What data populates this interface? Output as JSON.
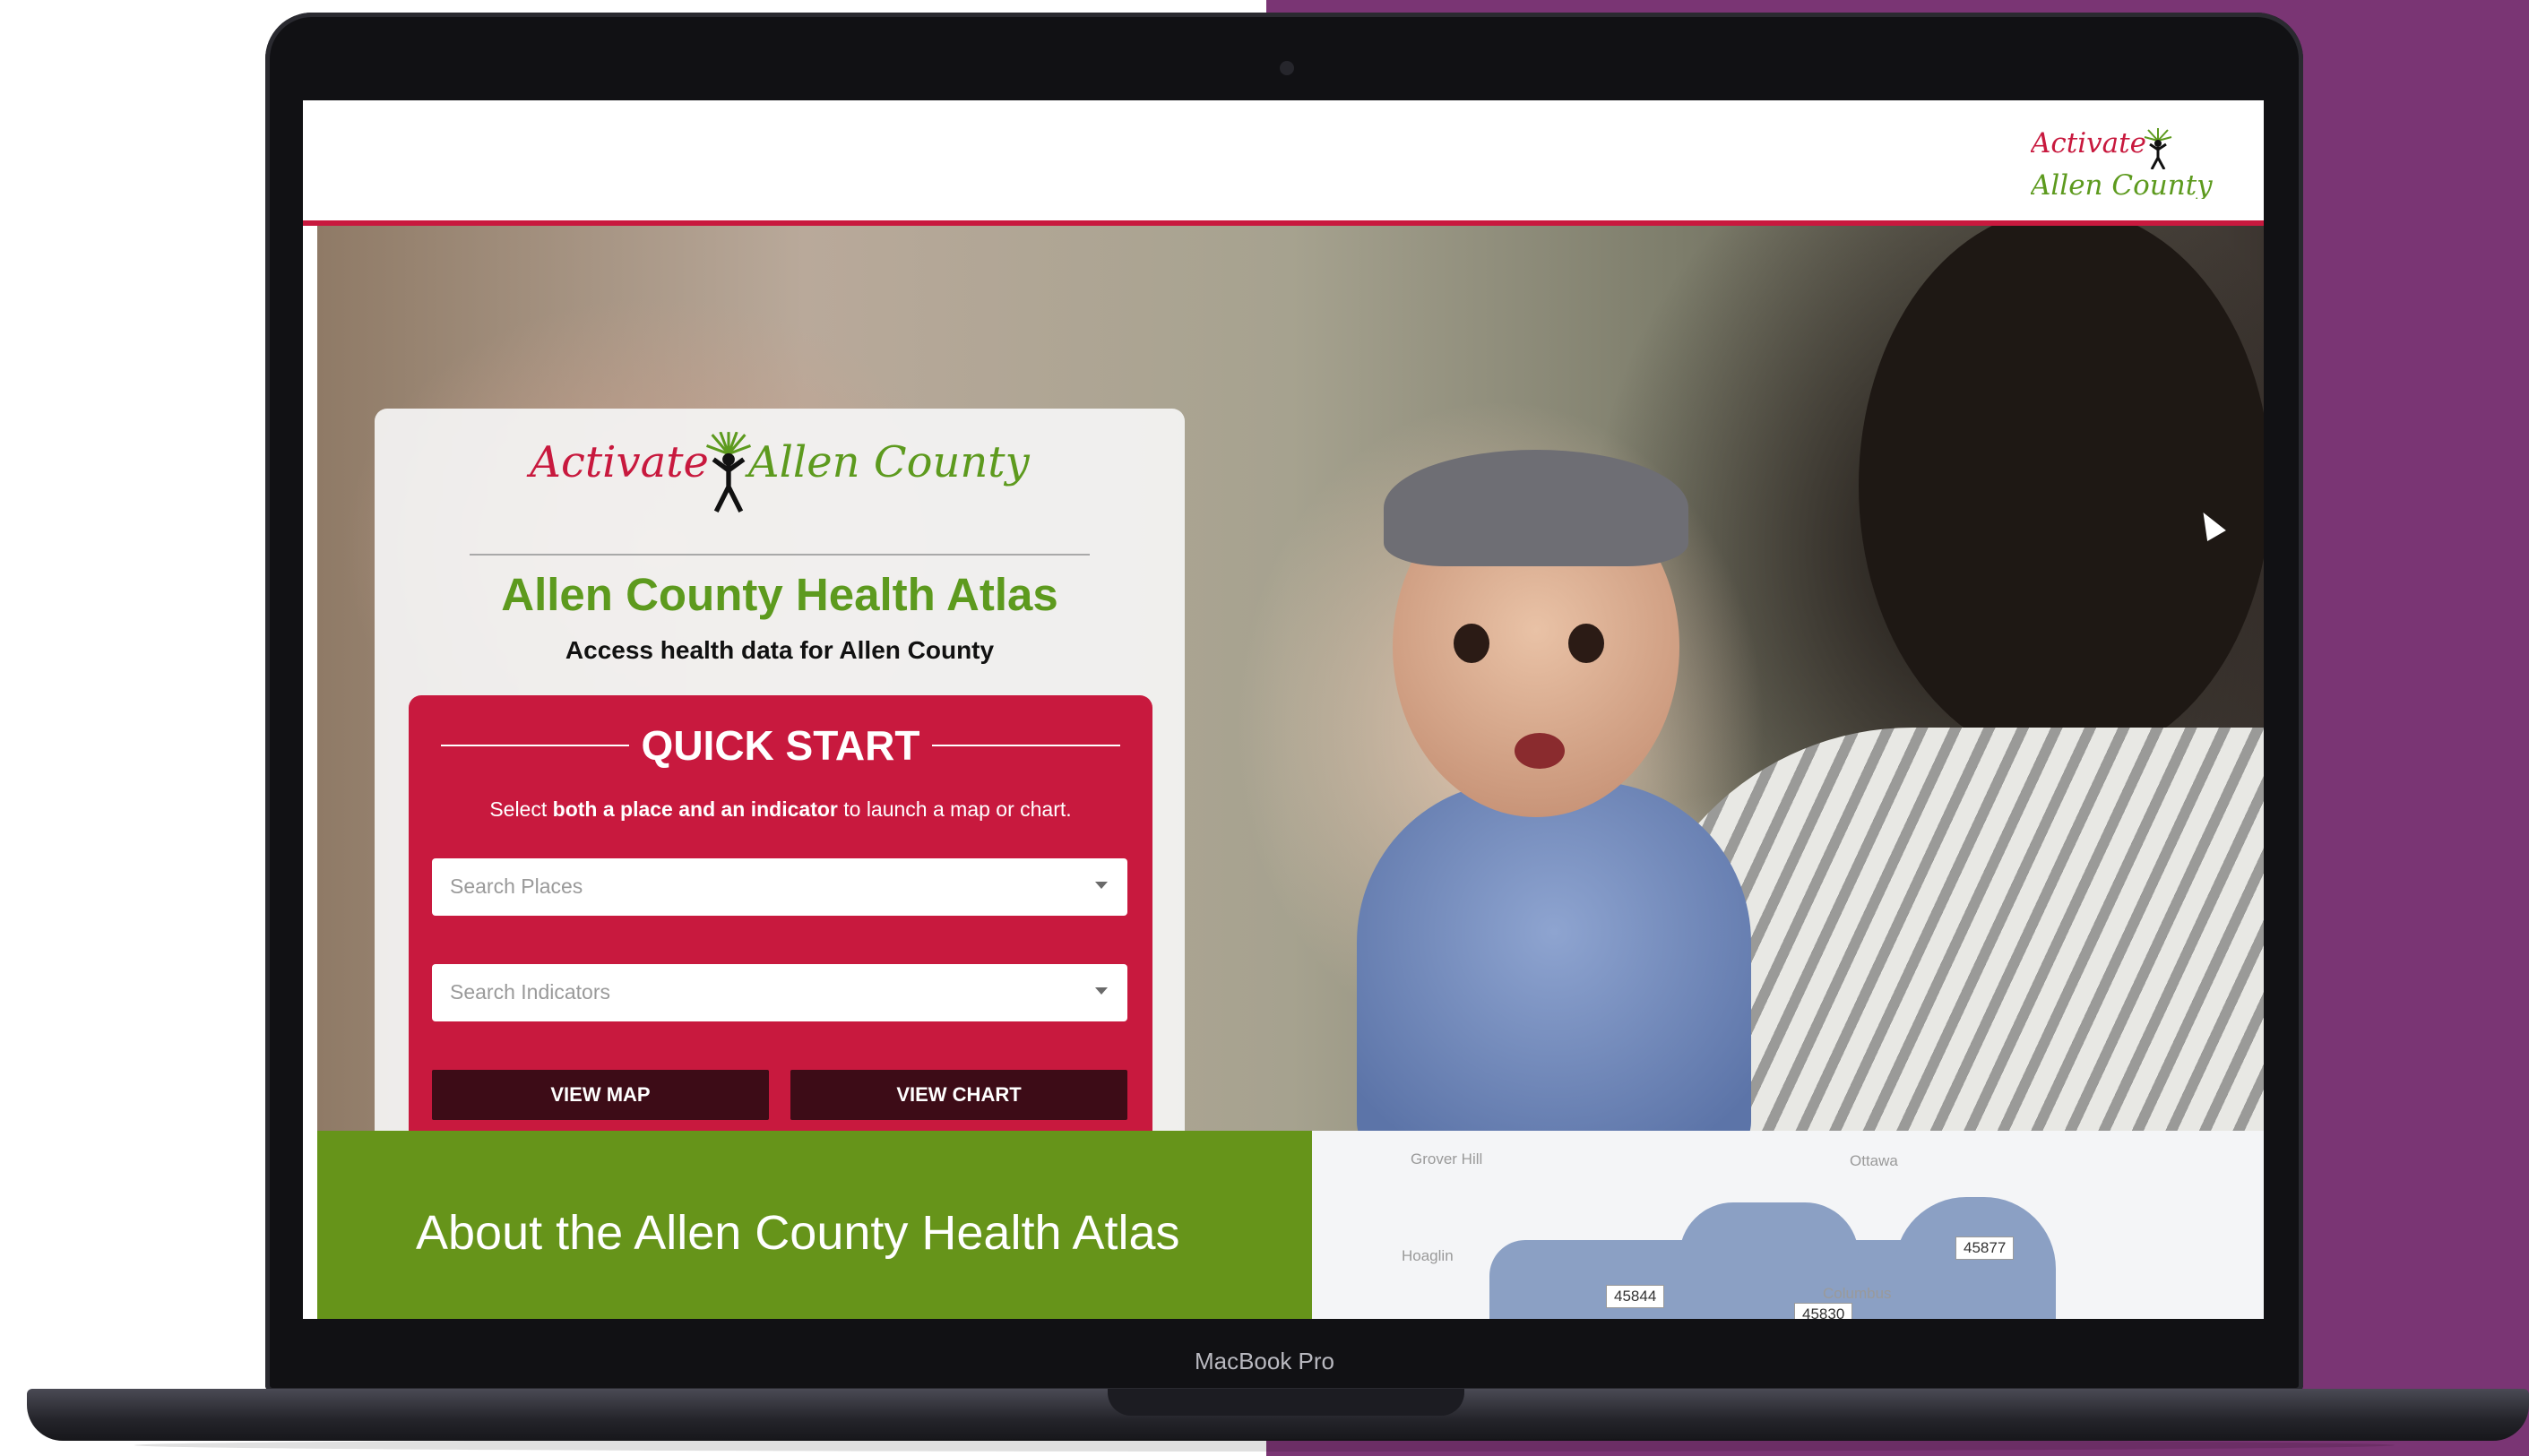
{
  "device": {
    "model_label": "MacBook Pro"
  },
  "header": {
    "logo": {
      "part1": "Activate",
      "part2": "Allen County"
    }
  },
  "hero_card": {
    "logo": {
      "part1": "Activate",
      "part2": "Allen County"
    },
    "title": "Allen County Health Atlas",
    "subtitle": "Access health data for Allen County"
  },
  "quick_start": {
    "title": "QUICK START",
    "instructions": {
      "prefix": "Select ",
      "bold": "both a place and an indicator",
      "suffix": " to launch a map or chart."
    },
    "places": {
      "placeholder": "Search Places"
    },
    "indicators": {
      "placeholder": "Search Indicators"
    },
    "view_map_label": "VIEW MAP",
    "view_chart_label": "VIEW CHART"
  },
  "about": {
    "title": "About the Allen County Health Atlas"
  },
  "map_preview": {
    "places": [
      "Grover Hill",
      "Ottawa",
      "Hoaglin",
      "Columbus"
    ],
    "zip_codes": [
      "45877",
      "45844",
      "45830"
    ],
    "region_color": "#8ba0c4"
  },
  "colors": {
    "brand_red": "#c8193e",
    "brand_green": "#5d9a1e",
    "about_green": "#66941a",
    "button_dark": "#3d0c17",
    "background_purple": "#7a3574"
  }
}
